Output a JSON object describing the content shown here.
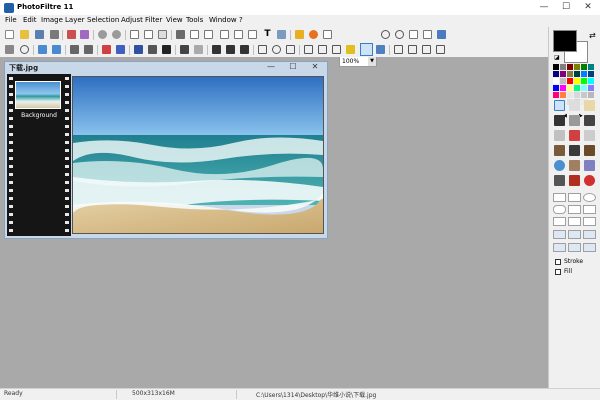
{
  "window": {
    "title": "PhotoFiltre 11",
    "minimize": "—",
    "maximize": "☐",
    "close": "✕"
  },
  "menu": [
    "File",
    "Edit",
    "Image",
    "Layer",
    "Selection",
    "Adjust",
    "Filter",
    "View",
    "Tools",
    "Window",
    "?"
  ],
  "toolbar": {
    "zoom_value": "100%",
    "text_tool_label": "T"
  },
  "document": {
    "title": "下载.jpg",
    "layer_name": "Background",
    "minimize": "—",
    "maximize": "☐",
    "close": "✕"
  },
  "tools": {
    "stroke_label": "Stroke",
    "fill_label": "Fill"
  },
  "status": {
    "state": "Ready",
    "dimensions": "500x313x16M",
    "path": "C:\\Users\\1314\\Desktop\\华维小说\\下载.jpg"
  },
  "colors": {
    "foreground": "#000000",
    "background": "#ffffff",
    "accent": "#3b7dc8"
  }
}
